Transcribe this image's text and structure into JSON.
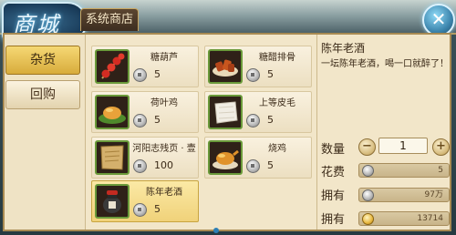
{
  "header": {
    "logo_text": "商城",
    "tab_label": "系统商店",
    "close_symbol": "✕"
  },
  "sidebar": {
    "items": [
      {
        "label": "杂货",
        "active": true
      },
      {
        "label": "回购",
        "active": false
      }
    ]
  },
  "items": [
    {
      "name": "糖葫芦",
      "price": "5",
      "icon": "candied-haws-icon"
    },
    {
      "name": "糖醋排骨",
      "price": "5",
      "icon": "sweet-sour-ribs-icon"
    },
    {
      "name": "荷叶鸡",
      "price": "5",
      "icon": "lotus-leaf-chicken-icon"
    },
    {
      "name": "上等皮毛",
      "price": "5",
      "icon": "fur-pelt-icon"
    },
    {
      "name": "河阳志残页 · 壹",
      "price": "100",
      "icon": "scroll-page-icon"
    },
    {
      "name": "烧鸡",
      "price": "5",
      "icon": "roast-chicken-icon"
    },
    {
      "name": "陈年老酒",
      "price": "5",
      "icon": "wine-jar-icon",
      "selected": true
    }
  ],
  "detail": {
    "title": "陈年老酒",
    "description": "一坛陈年老酒，喝一口就醉了！",
    "quantity_label": "数量",
    "quantity_value": "1",
    "minus_symbol": "−",
    "plus_symbol": "+",
    "cost_label": "花费",
    "cost_value": "5",
    "owned_label_1": "拥有",
    "owned_value_1": "97万",
    "owned_label_2": "拥有",
    "owned_value_2": "13714"
  },
  "colors": {
    "panel_bg": "#f2e6c9",
    "active_tab": "#d8ac3c",
    "selected_item": "#f0d27a",
    "thumb_border": "#6a9a3a"
  }
}
